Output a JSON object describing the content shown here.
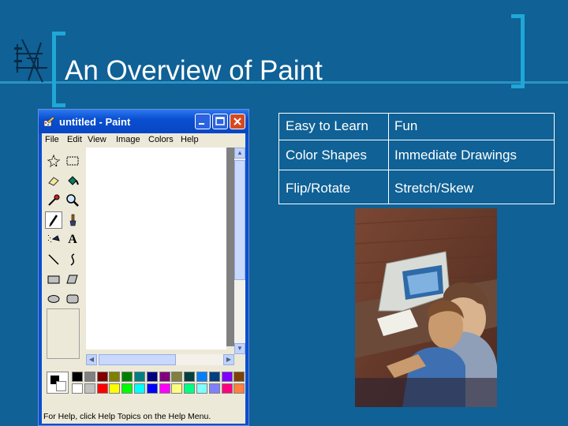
{
  "slide": {
    "title": "An Overview of Paint"
  },
  "paint_window": {
    "title": "untitled - Paint",
    "controls": [
      "minimize",
      "maximize",
      "close"
    ],
    "menu": [
      "File",
      "Edit",
      "View",
      "Image",
      "Colors",
      "Help"
    ],
    "tools": [
      {
        "name": "free-form-select-icon"
      },
      {
        "name": "select-icon"
      },
      {
        "name": "eraser-icon"
      },
      {
        "name": "fill-with-color-icon"
      },
      {
        "name": "pick-color-icon"
      },
      {
        "name": "magnifier-icon"
      },
      {
        "name": "pencil-icon"
      },
      {
        "name": "brush-icon"
      },
      {
        "name": "airbrush-icon"
      },
      {
        "name": "text-icon",
        "glyph": "A"
      },
      {
        "name": "line-icon"
      },
      {
        "name": "curve-icon"
      },
      {
        "name": "rectangle-icon"
      },
      {
        "name": "polygon-icon"
      },
      {
        "name": "ellipse-icon"
      },
      {
        "name": "rounded-rectangle-icon"
      }
    ],
    "selected_tool": "pencil-icon",
    "palette_top": [
      "#000000",
      "#808080",
      "#800000",
      "#808000",
      "#008000",
      "#008080",
      "#000080",
      "#800080",
      "#808040",
      "#004040",
      "#0080ff",
      "#004080",
      "#8000ff",
      "#804000"
    ],
    "palette_bottom": [
      "#ffffff",
      "#c0c0c0",
      "#ff0000",
      "#ffff00",
      "#00ff00",
      "#00ffff",
      "#0000ff",
      "#ff00ff",
      "#ffff80",
      "#00ff80",
      "#80ffff",
      "#8080ff",
      "#ff0080",
      "#ff8040"
    ],
    "foreground_color": "#000000",
    "background_color": "#ffffff",
    "status_text": "For Help, click Help Topics on the Help Menu."
  },
  "features_table": {
    "rows": [
      [
        "Easy to Learn",
        "Fun"
      ],
      [
        "Color Shapes",
        "Immediate Drawings"
      ],
      [
        "Flip/Rotate",
        "Stretch/Skew"
      ]
    ]
  },
  "colors": {
    "background": "#0f6196",
    "accent": "#1fa7d6",
    "title_bar": "#0a4fd0"
  }
}
